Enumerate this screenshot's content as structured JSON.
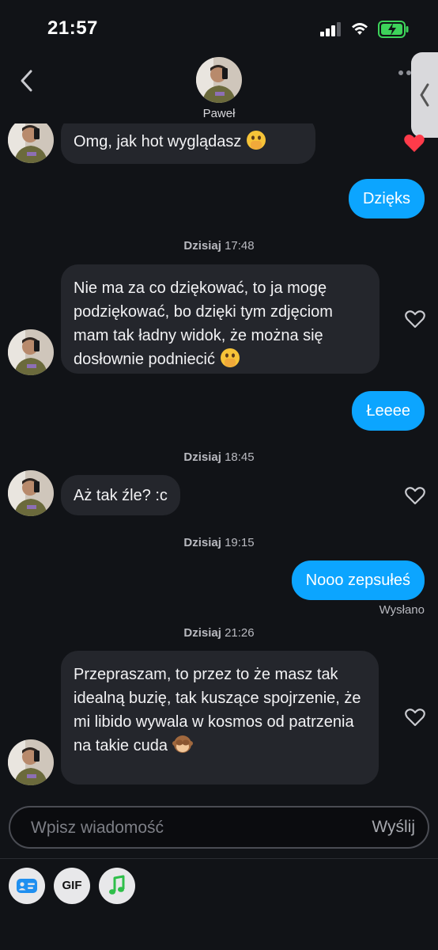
{
  "status_bar": {
    "time": "21:57"
  },
  "header": {
    "contact_name": "Paweł"
  },
  "messages": [
    {
      "text": "Omg, jak hot wyglądasz",
      "emoji": "hands-over-mouth-emoji"
    },
    {
      "text": "Dzięks"
    },
    {
      "day": "Dzisiaj",
      "time": "17:48"
    },
    {
      "text": "Nie ma za co dziękować, to ja mogę podziękować, bo dzięki tym zdjęciom mam tak ładny widok, że można się dosłownie podniecić",
      "emoji": "hands-over-mouth-emoji"
    },
    {
      "text": "Łeeee"
    },
    {
      "day": "Dzisiaj",
      "time": "18:45"
    },
    {
      "text": "Aż tak źle? :c"
    },
    {
      "day": "Dzisiaj",
      "time": "19:15"
    },
    {
      "text": "Nooo zepsułeś",
      "status": "Wysłano"
    },
    {
      "day": "Dzisiaj",
      "time": "21:26"
    },
    {
      "text": "Przepraszam, to przez to że masz tak idealną buzię, tak kuszące spojrzenie, że mi libido wywala w kosmos od patrzenia na takie cuda",
      "emoji": "see-no-evil-monkey-emoji"
    }
  ],
  "composer": {
    "placeholder": "Wpisz wiadomość",
    "send_label": "Wyślij"
  },
  "toolbar": {
    "gif_label": "GIF",
    "icons": [
      "card-icon",
      "gif-icon",
      "music-note-icon"
    ]
  },
  "colors": {
    "outgoing_bubble": "#0ca5ff",
    "incoming_bubble": "#24262c",
    "background": "#111317",
    "music_green": "#2fbf4a"
  }
}
